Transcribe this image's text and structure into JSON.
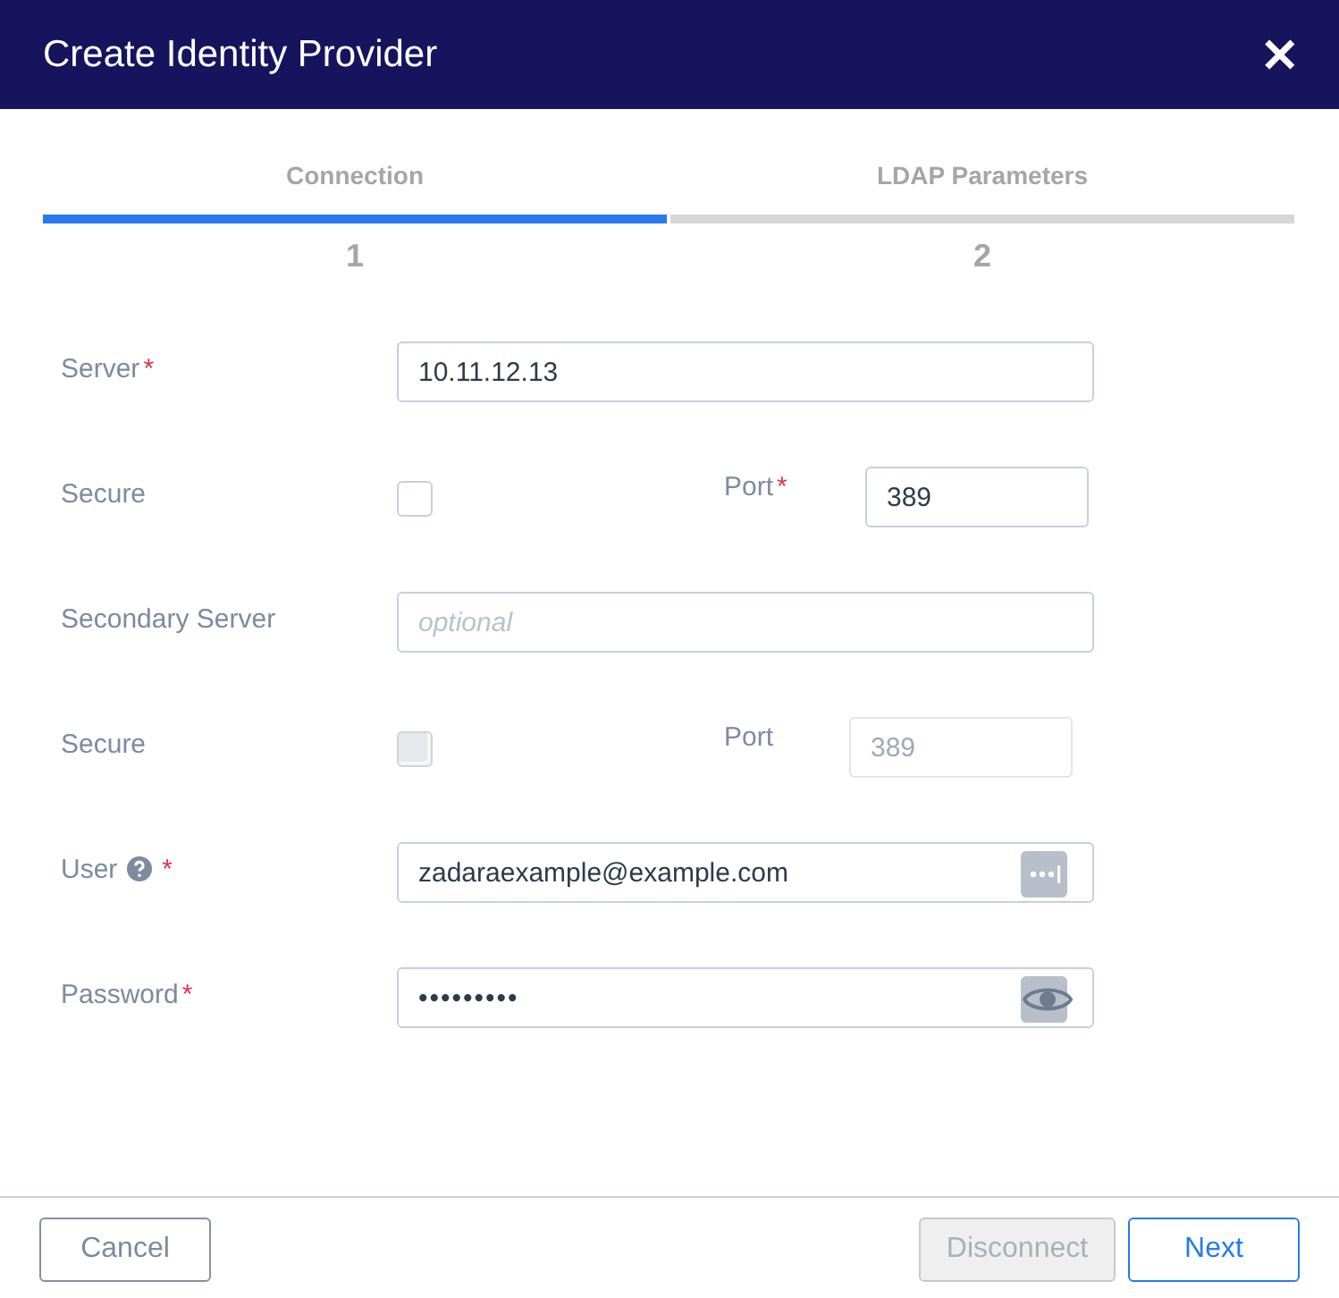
{
  "window": {
    "title": "Create Identity Provider",
    "close": "✕"
  },
  "steps": [
    {
      "label": "Connection",
      "number": "1",
      "selected": true
    },
    {
      "label": "LDAP Parameters",
      "number": "2",
      "selected": false
    }
  ],
  "rows": [
    {
      "kind": "text",
      "label": "Server",
      "required_mark": "*",
      "value": "10.11.12.13"
    },
    {
      "kind": "check_port",
      "label": "Secure",
      "checked": false,
      "disabled": false,
      "port_label": "Port",
      "port_required_mark": "*",
      "port_value": "389"
    },
    {
      "kind": "text",
      "label": "Secondary Server",
      "placeholder": "optional"
    },
    {
      "kind": "check_port",
      "label": "Secure",
      "checked": false,
      "disabled": true,
      "port_label": "Port",
      "port_value": "389"
    },
    {
      "kind": "text",
      "label": "User",
      "help": true,
      "required_mark": "*",
      "value": "zadaraexample@example.com",
      "manager_button": true
    },
    {
      "kind": "password",
      "label": "Password",
      "required_mark": "*",
      "value": "•••••••••",
      "reveal_button": true
    }
  ],
  "buttons": [
    {
      "label": "Cancel",
      "kind": "secondary",
      "disabled": false
    },
    {
      "label": "Disconnect",
      "kind": "secondary",
      "disabled": true
    },
    {
      "label": "Next",
      "kind": "primary",
      "disabled": false
    }
  ]
}
